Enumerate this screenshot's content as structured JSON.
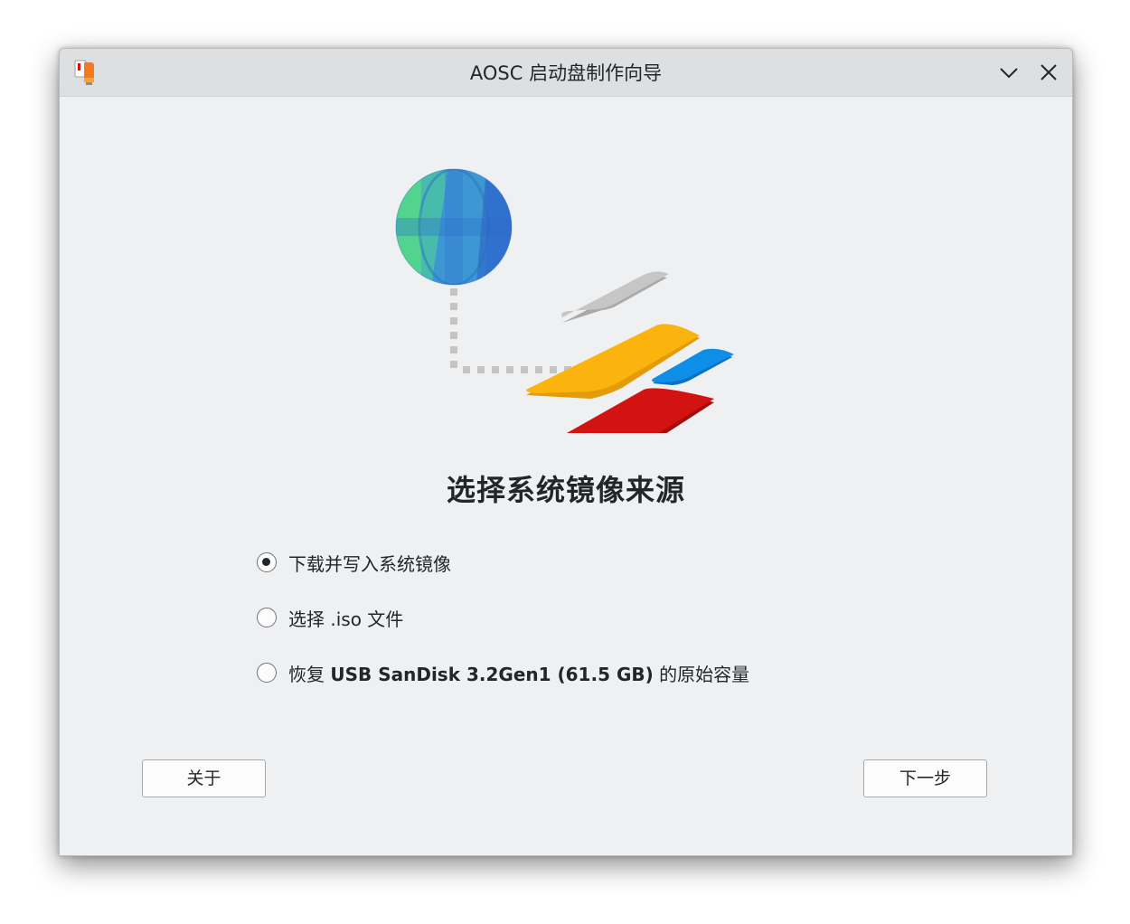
{
  "window": {
    "title": "AOSC 启动盘制作向导"
  },
  "titlebar": {
    "app_icon": "usb-drive-app-icon",
    "minimize_icon": "chevron-down-icon",
    "close_icon": "close-icon"
  },
  "illustration": {
    "icons": [
      "globe-icon",
      "storage-cards-illustration"
    ]
  },
  "main": {
    "heading": "选择系统镜像来源",
    "options": [
      {
        "label": "下载并写入系统镜像",
        "checked": true
      },
      {
        "label": "选择 .iso 文件",
        "checked": false
      },
      {
        "label_prefix": "恢复 ",
        "label_bold": "USB SanDisk 3.2Gen1 (61.5 GB)",
        "label_suffix": " 的原始容量",
        "checked": false
      }
    ]
  },
  "footer": {
    "about_label": "关于",
    "next_label": "下一步"
  },
  "colors": {
    "globe_green": "#52d48e",
    "globe_blue": "#3a86e0",
    "card_gray": "#c6c6c6",
    "card_yellow": "#fbb40e",
    "card_blue": "#0f8ee8",
    "card_red": "#d31212",
    "window_bg": "#eff0f1",
    "titlebar_bg": "#dedfe1"
  }
}
